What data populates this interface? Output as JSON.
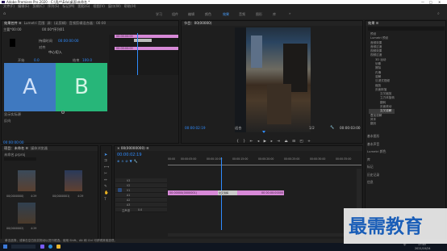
{
  "window": {
    "title": "Adobe Premiere Pro 2020 - C:\\用户\\Edu\\桌面\\未命名 *"
  },
  "menu": [
    "文件(F)",
    "编辑(E)",
    "剪辑(C)",
    "序列(S)",
    "标记(M)",
    "图形(G)",
    "视图(V)",
    "窗口(W)",
    "帮助(H)"
  ],
  "workspaces": [
    "学习",
    "组件",
    "编辑",
    "颜色",
    "效果",
    "音频",
    "图形",
    "库"
  ],
  "active_workspace": "效果",
  "effect_controls": {
    "tabs": [
      "效果控件 ≡",
      "Lumetri 范围",
      "源：(无剪辑)",
      "音频剪辑混合器：00:00"
    ],
    "source_label": "主要*00:00",
    "seq_label": "00:00*序列01",
    "rows": [
      "持续时间",
      "对齐",
      "中心偏移"
    ],
    "align_value": "中心切入",
    "labelA": "A",
    "labelB": "B",
    "startLbl": "开始",
    "endLbl": "结束",
    "chk1": "显示实际源",
    "chk2": "反向",
    "clip_name": "00:00:00:00",
    "timecode": "00:00:00:00"
  },
  "program": {
    "tab": "节目：00(00000)",
    "timecode": "00:00:02:19",
    "fit": "适合",
    "ratio": "1/2",
    "duration": "00:00:03:00"
  },
  "effects": {
    "title": "效果 ≡",
    "tree": [
      "预设",
      "Lumetri 预设",
      "音频效果",
      "音频过渡",
      "视频效果",
      "视频过渡",
      "3D 运动",
      "划像",
      "擦除",
      "内滑",
      "溶解",
      "沉浸式视频",
      "缩放",
      "页面剥落",
      "交叉缩放",
      "立方体旋转",
      "翻转",
      "页面滚动",
      "交叉溶解",
      "叠加溶解",
      "风车",
      "翻页",
      "交叉划像",
      "带状滑动"
    ],
    "bottom": [
      "基本图形",
      "基本声音",
      "Lumetri 颜色",
      "库",
      "标记",
      "历史记录",
      "信息"
    ]
  },
  "project": {
    "tabs": [
      "项目：未命名 ≡",
      "媒体浏览器"
    ],
    "path": "未命名.prproj",
    "items": [
      "00(0000000)",
      "00(0000001)",
      "00(0000002)"
    ],
    "durations": [
      "4:29",
      "4:29",
      "4:29"
    ]
  },
  "timeline": {
    "tab": "× 00(00000000) ≡",
    "timecode": "00:00:02:19",
    "ruler": [
      "00:00",
      "00:00:05:00",
      "00:00:10:00",
      "00:00:15:00",
      "00:00:20:00",
      "00:00:25:00",
      "00:00:30:00",
      "00:00:35:00"
    ],
    "tracks": [
      "V3",
      "V2",
      "V1",
      "A1",
      "A2",
      "A3",
      "主声道"
    ],
    "master_val": "0.0",
    "clip_main": "00:00000(0000001)",
    "clip_trans": "交叉溶解",
    "clip_small": "00 00:00:00000"
  },
  "status": "单击选择，或单击空白处并拖动以进行框选。使用 Shift、Alt 和 Ctrl 可获得其他选项。",
  "taskbar": {
    "time": "17:45",
    "date": "2021/10/24",
    "lang": "中"
  },
  "watermark": "最需教育",
  "colors": {
    "accent": "#2f8cff",
    "clip": "#d789d7",
    "labelA": "#3f79c0",
    "labelB": "#27b679"
  }
}
